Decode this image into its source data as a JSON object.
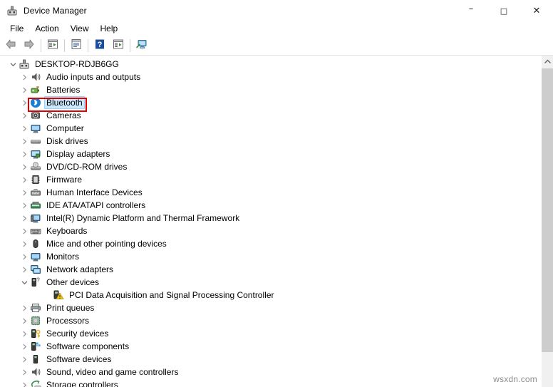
{
  "window": {
    "title": "Device Manager",
    "icon": "device-manager-icon",
    "caption": {
      "minimize": "–",
      "maximize": "□",
      "close": "✕"
    }
  },
  "menubar": {
    "items": [
      {
        "label": "File",
        "name": "menu-file"
      },
      {
        "label": "Action",
        "name": "menu-action"
      },
      {
        "label": "View",
        "name": "menu-view"
      },
      {
        "label": "Help",
        "name": "menu-help"
      }
    ]
  },
  "toolbar": {
    "buttons": [
      {
        "name": "back-button",
        "icon": "back-arrow-icon",
        "tooltip": "Back"
      },
      {
        "name": "forward-button",
        "icon": "forward-arrow-icon",
        "tooltip": "Forward"
      },
      {
        "name": "show-hide-console-tree-button",
        "icon": "console-tree-icon",
        "tooltip": "Show/Hide Console Tree"
      },
      {
        "name": "properties-button",
        "icon": "properties-icon",
        "tooltip": "Properties"
      },
      {
        "name": "help-button",
        "icon": "help-question-icon",
        "tooltip": "Help"
      },
      {
        "name": "update-driver-button",
        "icon": "update-driver-icon",
        "tooltip": "Update driver"
      },
      {
        "name": "scan-hardware-changes-button",
        "icon": "scan-monitor-icon",
        "tooltip": "Scan for hardware changes"
      }
    ]
  },
  "tree": {
    "rows": [
      {
        "label": "DESKTOP-RDJB6GG",
        "depth": 0,
        "state": "expanded",
        "icon": "computer-root-icon",
        "selected": false
      },
      {
        "label": "Audio inputs and outputs",
        "depth": 1,
        "state": "collapsed",
        "icon": "speaker-icon",
        "selected": false
      },
      {
        "label": "Batteries",
        "depth": 1,
        "state": "collapsed",
        "icon": "battery-icon",
        "selected": false
      },
      {
        "label": "Bluetooth",
        "depth": 1,
        "state": "collapsed",
        "icon": "bluetooth-icon",
        "selected": true
      },
      {
        "label": "Cameras",
        "depth": 1,
        "state": "collapsed",
        "icon": "camera-icon",
        "selected": false
      },
      {
        "label": "Computer",
        "depth": 1,
        "state": "collapsed",
        "icon": "monitor-icon",
        "selected": false
      },
      {
        "label": "Disk drives",
        "depth": 1,
        "state": "collapsed",
        "icon": "disk-drive-icon",
        "selected": false
      },
      {
        "label": "Display adapters",
        "depth": 1,
        "state": "collapsed",
        "icon": "display-adapter-icon",
        "selected": false
      },
      {
        "label": "DVD/CD-ROM drives",
        "depth": 1,
        "state": "collapsed",
        "icon": "optical-drive-icon",
        "selected": false
      },
      {
        "label": "Firmware",
        "depth": 1,
        "state": "collapsed",
        "icon": "firmware-chip-icon",
        "selected": false
      },
      {
        "label": "Human Interface Devices",
        "depth": 1,
        "state": "collapsed",
        "icon": "hid-icon",
        "selected": false
      },
      {
        "label": "IDE ATA/ATAPI controllers",
        "depth": 1,
        "state": "collapsed",
        "icon": "ide-controller-icon",
        "selected": false
      },
      {
        "label": "Intel(R) Dynamic Platform and Thermal Framework",
        "depth": 1,
        "state": "collapsed",
        "icon": "thermal-framework-icon",
        "selected": false
      },
      {
        "label": "Keyboards",
        "depth": 1,
        "state": "collapsed",
        "icon": "keyboard-icon",
        "selected": false
      },
      {
        "label": "Mice and other pointing devices",
        "depth": 1,
        "state": "collapsed",
        "icon": "mouse-icon",
        "selected": false
      },
      {
        "label": "Monitors",
        "depth": 1,
        "state": "collapsed",
        "icon": "monitor-icon",
        "selected": false
      },
      {
        "label": "Network adapters",
        "depth": 1,
        "state": "collapsed",
        "icon": "network-adapter-icon",
        "selected": false
      },
      {
        "label": "Other devices",
        "depth": 1,
        "state": "expanded",
        "icon": "unknown-device-icon",
        "selected": false
      },
      {
        "label": "PCI Data Acquisition and Signal Processing Controller",
        "depth": 2,
        "state": "leaf",
        "icon": "warning-device-icon",
        "selected": false
      },
      {
        "label": "Print queues",
        "depth": 1,
        "state": "collapsed",
        "icon": "printer-icon",
        "selected": false
      },
      {
        "label": "Processors",
        "depth": 1,
        "state": "collapsed",
        "icon": "processor-icon",
        "selected": false
      },
      {
        "label": "Security devices",
        "depth": 1,
        "state": "collapsed",
        "icon": "security-key-icon",
        "selected": false
      },
      {
        "label": "Software components",
        "depth": 1,
        "state": "collapsed",
        "icon": "software-component-icon",
        "selected": false
      },
      {
        "label": "Software devices",
        "depth": 1,
        "state": "collapsed",
        "icon": "software-device-icon",
        "selected": false
      },
      {
        "label": "Sound, video and game controllers",
        "depth": 1,
        "state": "collapsed",
        "icon": "sound-video-icon",
        "selected": false
      },
      {
        "label": "Storage controllers",
        "depth": 1,
        "state": "collapsed",
        "icon": "storage-controller-icon",
        "selected": false
      }
    ]
  },
  "annotation": {
    "target_row_label": "Bluetooth",
    "color": "#e00000"
  },
  "scrollbar": {
    "up_arrow": "˄",
    "orientation": "vertical"
  },
  "watermark": {
    "text": "wsxdn.com"
  }
}
